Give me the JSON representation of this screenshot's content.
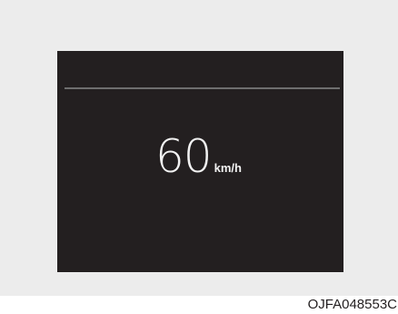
{
  "display": {
    "speed_value": "60",
    "speed_unit": "km/h"
  },
  "caption": "OJFA048553C",
  "colors": {
    "frame_background": "#ececec",
    "display_background": "#231f20",
    "divider": "#6e6e6e",
    "text": "#f2f2f2"
  }
}
